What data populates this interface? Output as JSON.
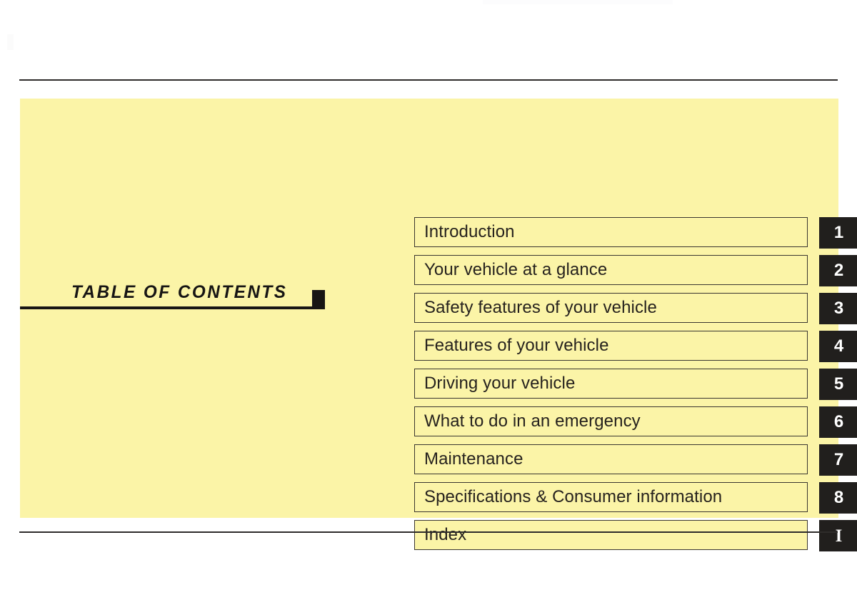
{
  "page": {
    "background_color": "#ffffff",
    "panel_color": "#fbf4a7",
    "rule_color": "#2e2c2a",
    "tab_color": "#211f1d",
    "text_color": "#26221e"
  },
  "section": {
    "title": "TABLE  OF  CONTENTS"
  },
  "toc": {
    "entries": [
      {
        "label": "Introduction",
        "tab": "1",
        "tab_style": "sans"
      },
      {
        "label": "Your vehicle at a glance",
        "tab": "2",
        "tab_style": "sans"
      },
      {
        "label": "Safety features of your vehicle",
        "tab": "3",
        "tab_style": "sans"
      },
      {
        "label": "Features of your vehicle",
        "tab": "4",
        "tab_style": "sans"
      },
      {
        "label": "Driving your vehicle",
        "tab": "5",
        "tab_style": "sans"
      },
      {
        "label": "What to do in an emergency",
        "tab": "6",
        "tab_style": "sans"
      },
      {
        "label": "Maintenance",
        "tab": "7",
        "tab_style": "sans"
      },
      {
        "label": "Specifications & Consumer information",
        "tab": "8",
        "tab_style": "sans"
      },
      {
        "label": "Index",
        "tab": "I",
        "tab_style": "serif"
      }
    ]
  }
}
